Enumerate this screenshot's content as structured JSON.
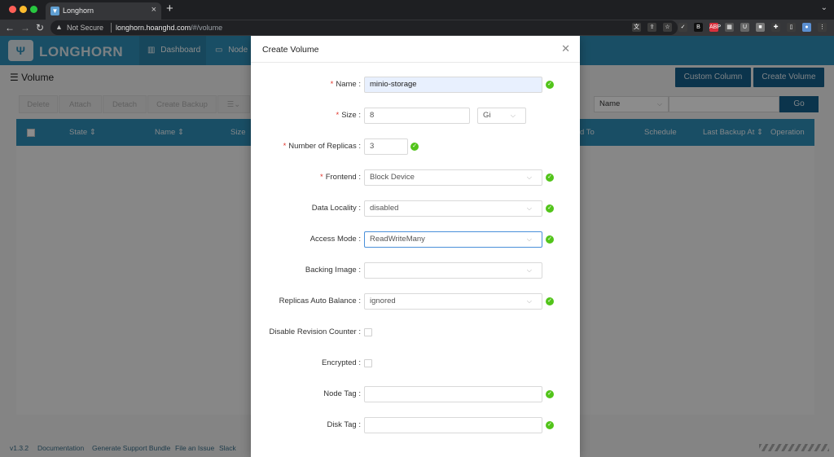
{
  "browser": {
    "tab_title": "Longhorn",
    "not_secure": "Not Secure",
    "url_host": "longhorn.hoanghd.com",
    "url_path": "/#/volume",
    "traffic_colors": [
      "#ff5f57",
      "#febc2e",
      "#28c840"
    ],
    "extensions": [
      {
        "name": "translate-icon",
        "label": "文",
        "color": "#3c3c3c"
      },
      {
        "name": "share-icon",
        "label": "⇪",
        "color": "#3c3c3c"
      },
      {
        "name": "star-icon",
        "label": "☆",
        "color": "#3c3c3c"
      },
      {
        "name": "check-ext-icon",
        "label": "✓",
        "color": "#3c3c3c"
      },
      {
        "name": "ext-b-icon",
        "label": "B",
        "color": "#111111"
      },
      {
        "name": "abp-icon",
        "label": "ABP",
        "color": "#d9303c"
      },
      {
        "name": "ext-grid-icon",
        "label": "▦",
        "color": "#555555"
      },
      {
        "name": "shield-ext-icon",
        "label": "U",
        "color": "#666666"
      },
      {
        "name": "ext-square-icon",
        "label": "■",
        "color": "#777777"
      },
      {
        "name": "puzzle-icon",
        "label": "✚",
        "color": "#3c3c3c"
      },
      {
        "name": "sidebar-icon",
        "label": "▯",
        "color": "#3c3c3c"
      },
      {
        "name": "profile-avatar-icon",
        "label": "●",
        "color": "#5b8fd1"
      },
      {
        "name": "menu-dots-icon",
        "label": "⋮",
        "color": "#3c3c3c"
      }
    ]
  },
  "app": {
    "logo_text": "LONGHORN",
    "nav": [
      {
        "label": "Dashboard",
        "icon": "chart-icon"
      },
      {
        "label": "Node",
        "icon": "monitor-icon"
      }
    ],
    "page_title": "Volume",
    "buttons": {
      "custom_column": "Custom Column",
      "create_volume": "Create Volume",
      "go": "Go"
    },
    "actions": [
      "Delete",
      "Attach",
      "Detach",
      "Create Backup"
    ],
    "search_field": "Name",
    "table_columns": [
      "State",
      "Name",
      "Size",
      "d To",
      "Schedule",
      "Last Backup At",
      "Operation"
    ],
    "footer": [
      "v1.3.2",
      "Documentation",
      "Generate Support Bundle",
      "File an Issue",
      "Slack"
    ],
    "colors": {
      "primary": "#2f8fb8",
      "dark": "#155f8b",
      "success": "#52c41a",
      "required": "#e2342b"
    }
  },
  "modal": {
    "title": "Create Volume",
    "fields": {
      "name": {
        "label": "Name",
        "value": "minio-storage",
        "required": true
      },
      "size": {
        "label": "Size",
        "value": "8",
        "unit": "Gi",
        "required": true
      },
      "replicas": {
        "label": "Number of Replicas",
        "value": "3",
        "required": true
      },
      "frontend": {
        "label": "Frontend",
        "value": "Block Device",
        "required": true
      },
      "data_locality": {
        "label": "Data Locality",
        "value": "disabled"
      },
      "access_mode": {
        "label": "Access Mode",
        "value": "ReadWriteMany"
      },
      "backing_image": {
        "label": "Backing Image",
        "value": ""
      },
      "replicas_auto_balance": {
        "label": "Replicas Auto Balance",
        "value": "ignored"
      },
      "disable_revision_counter": {
        "label": "Disable Revision Counter",
        "checked": false
      },
      "encrypted": {
        "label": "Encrypted",
        "checked": false
      },
      "node_tag": {
        "label": "Node Tag",
        "value": ""
      },
      "disk_tag": {
        "label": "Disk Tag",
        "value": ""
      }
    }
  }
}
